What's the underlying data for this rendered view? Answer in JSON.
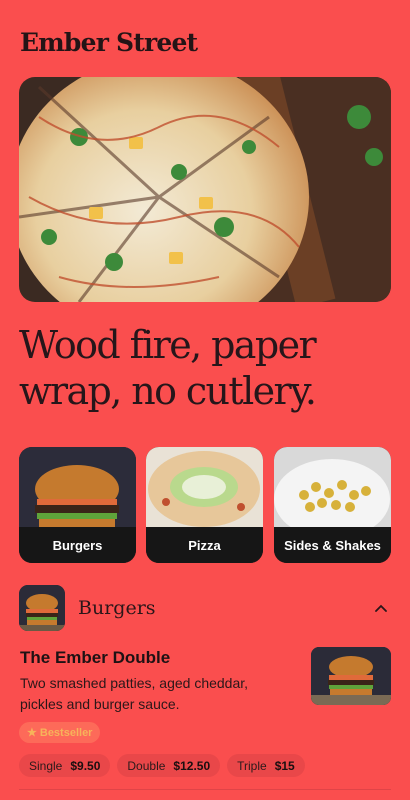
{
  "brand": {
    "name": "Ember Street"
  },
  "hero": {
    "image": "pizza-on-board-photo"
  },
  "headline": "Wood fire, paper wrap, no cutlery.",
  "categories": [
    {
      "label": "Burgers",
      "image": "burger-photo"
    },
    {
      "label": "Pizza",
      "image": "pizza-photo"
    },
    {
      "label": "Sides & Shakes",
      "image": "corn-bowl-photo"
    }
  ],
  "section": {
    "title": "Burgers",
    "thumb": "burger-photo",
    "icon": "chevron-up-icon"
  },
  "item": {
    "title": "The Ember Double",
    "description": "Two smashed patties, aged cheddar, pickles and burger sauce.",
    "badge": {
      "icon": "star-icon",
      "label": "Bestseller"
    },
    "options": [
      {
        "name": "Single",
        "price": "$9.50"
      },
      {
        "name": "Double",
        "price": "$12.50"
      },
      {
        "name": "Triple",
        "price": "$15"
      }
    ]
  },
  "colors": {
    "background": "#fa4e4e",
    "card": "#161616",
    "accent": "#f7b35a"
  }
}
